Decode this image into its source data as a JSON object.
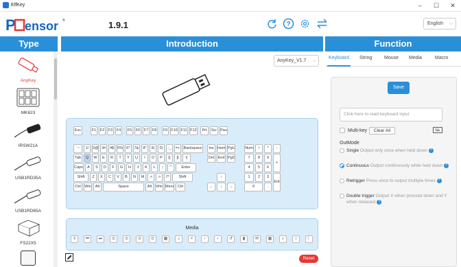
{
  "window": {
    "title": "ElfKey",
    "minimize": "–",
    "maximize": "☐",
    "close": "✕"
  },
  "header": {
    "brand_logo": "PCsensor",
    "version": "1.9.1",
    "language": "English"
  },
  "columns": {
    "type": "Type",
    "introduction": "Introduction",
    "function": "Function"
  },
  "type_list": {
    "items": [
      {
        "label": "AnyKey",
        "selected": true
      },
      {
        "label": "MK623"
      },
      {
        "label": "IRSW21A"
      },
      {
        "label": "USB1RD35A"
      },
      {
        "label": "USB1RD65A"
      },
      {
        "label": "FS22X5"
      }
    ]
  },
  "device_select": {
    "value": "AnyKey_V1.7"
  },
  "keyboard": {
    "rows": [
      [
        "Esc",
        "F1",
        "F2",
        "F3",
        "F4",
        "F5",
        "F6",
        "F7",
        "F8",
        "F9",
        "F10",
        "F11",
        "F12",
        "Prt",
        "Scr",
        "Pau"
      ],
      [
        "`~",
        "1!",
        "2@",
        "3#",
        "4$",
        "5%",
        "6^",
        "7&",
        "8*",
        "9(",
        "0)",
        "-_",
        "=+",
        "Backspace",
        "Ins",
        "Hom",
        "PgU",
        "Num",
        "/",
        "*",
        "-"
      ],
      [
        "Tab",
        "Q",
        "W",
        "E",
        "R",
        "T",
        "Y",
        "U",
        "I",
        "O",
        "P",
        "[{",
        "]}",
        "\\|",
        "Del",
        "End",
        "PgD",
        "7",
        "8",
        "9",
        "+"
      ],
      [
        "Caps",
        "A",
        "S",
        "D",
        "F",
        "G",
        "H",
        "J",
        "K",
        "L",
        ";:",
        "'\"",
        "Enter",
        "4",
        "5",
        "6"
      ],
      [
        "Shift",
        "Z",
        "X",
        "C",
        "V",
        "B",
        "N",
        "M",
        ",<",
        ".>",
        "/?",
        "Shift",
        "↑",
        "1",
        "2",
        "3",
        "Ent"
      ],
      [
        "Ctrl",
        "Win",
        "Alt",
        "Space",
        "Alt",
        "Win",
        "Menu",
        "Ctrl",
        "←",
        "↓",
        "→",
        "0",
        "."
      ]
    ],
    "highlighted": "Q"
  },
  "media": {
    "title": "Media",
    "icons": [
      "prev-track-icon",
      "play-pause-icon",
      "next-track-icon",
      "stop-icon",
      "record-icon",
      "volume-icon",
      "mute-icon",
      "calculator-icon",
      "home-icon",
      "close-icon",
      "back-icon",
      "forward-icon",
      "refresh-icon",
      "browser-icon",
      "mail-icon",
      "file-icon",
      "search-icon",
      "favorite-icon",
      "sleep-icon"
    ]
  },
  "footer": {
    "reset": "Reset"
  },
  "function_panel": {
    "tabs": [
      "Keyboard",
      "String",
      "Mouse",
      "Media",
      "Macro"
    ],
    "active_tab": "Keyboard",
    "save": "Save",
    "input_placeholder": "Click here to read keyboard input",
    "multikey": "Multi-key",
    "clear_all": "Clear All",
    "outmode_label": "OutMode",
    "modes": [
      {
        "name": "Single",
        "desc": "Output only once when held down",
        "selected": false
      },
      {
        "name": "Continuous",
        "desc": "Output continuously while held down",
        "selected": true
      },
      {
        "name": "Retrigger",
        "desc": "Press once to output multiple times",
        "selected": false
      },
      {
        "name": "Double trigger",
        "desc": "Output X when pressed down and Y when released",
        "selected": false
      }
    ]
  },
  "colors": {
    "accent": "#2a8fd9",
    "reset": "#e53935",
    "panel": "#d9ecf9"
  }
}
